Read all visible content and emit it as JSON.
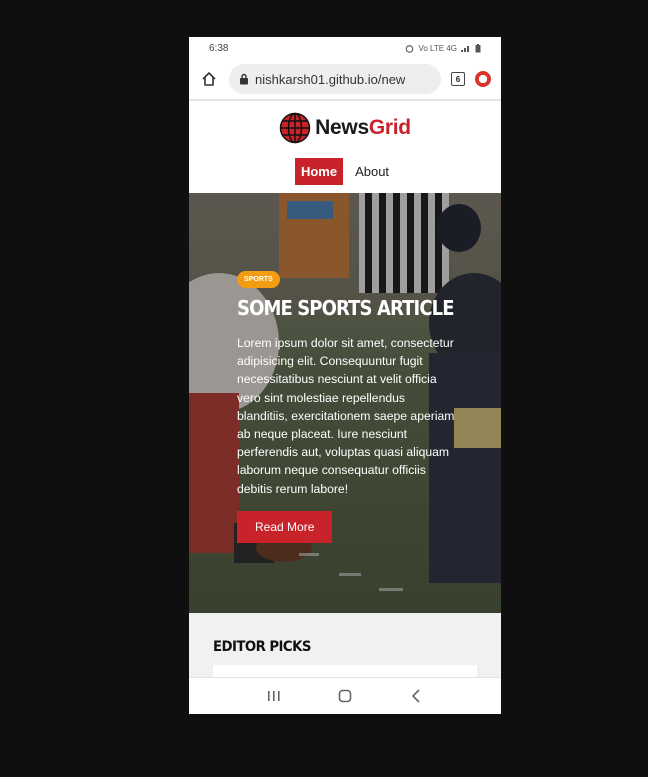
{
  "status_bar": {
    "time": "6:38",
    "indicators": "Vo LTE 4G"
  },
  "browser": {
    "url": "nishkarsh01.github.io/new",
    "tab_count": "6"
  },
  "site": {
    "logo_part1": "News",
    "logo_part2": "Grid",
    "nav": [
      "Home",
      "About"
    ]
  },
  "hero": {
    "category": "SPORTS",
    "title": "SOME SPORTS ARTICLE",
    "body": "Lorem ipsum dolor sit amet, consectetur adipisicing elit. Consequuntur fugit necessitatibus nesciunt at velit officia vero sint molestiae repellendus blanditiis, exercitationem saepe aperiam ab neque placeat. Iure nesciunt perferendis aut, voluptas quasi aliquam laborum neque consequatur officiis debitis rerum labore!",
    "button": "Read More"
  },
  "picks": {
    "title": "EDITOR PICKS"
  },
  "colors": {
    "accent": "#c8232a",
    "badge": "#f39c12"
  }
}
